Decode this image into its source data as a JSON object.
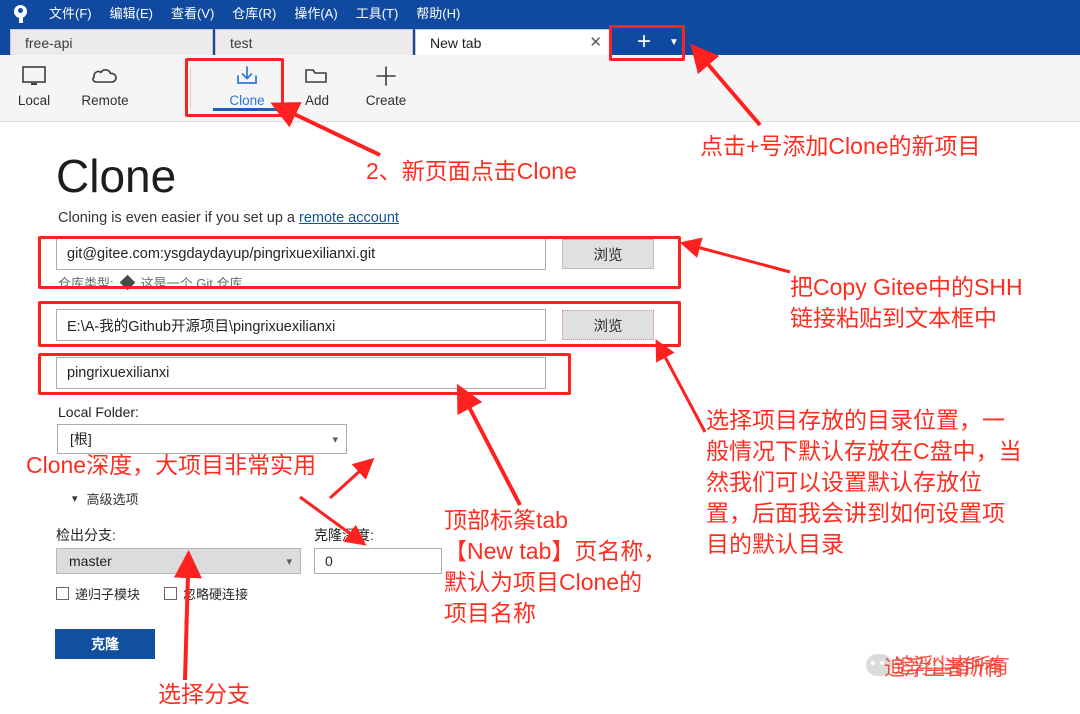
{
  "app": {
    "logo_icon": "sourcetree-logo-icon",
    "menu": [
      {
        "label": "文件(F)"
      },
      {
        "label": "编辑(E)"
      },
      {
        "label": "查看(V)"
      },
      {
        "label": "仓库(R)"
      },
      {
        "label": "操作(A)"
      },
      {
        "label": "工具(T)"
      },
      {
        "label": "帮助(H)"
      }
    ],
    "accent_color": "#1049a0",
    "annotation_color": "#ff2d20"
  },
  "tabs": {
    "items": [
      {
        "label": "free-api",
        "active": false,
        "closable": false
      },
      {
        "label": "test",
        "active": false,
        "closable": false
      },
      {
        "label": "New tab",
        "active": true,
        "closable": true,
        "close_icon": "close-icon"
      }
    ],
    "new_tab_icon": "plus-icon",
    "new_tab_caret_icon": "chevron-down-icon"
  },
  "ribbon": {
    "buttons": [
      {
        "label": "Local",
        "icon": "monitor-icon",
        "selected": false
      },
      {
        "label": "Remote",
        "icon": "cloud-icon",
        "selected": false
      },
      {
        "label": "Clone",
        "icon": "download-icon",
        "selected": true
      },
      {
        "label": "Add",
        "icon": "folder-icon",
        "selected": false
      },
      {
        "label": "Create",
        "icon": "plus-icon",
        "selected": false
      }
    ]
  },
  "main": {
    "title": "Clone",
    "subtitle_prefix": "Cloning is even easier if you set up a ",
    "subtitle_link": "remote account",
    "source_url": {
      "value": "git@gitee.com:ysgdaydayup/pingrixuexilianxi.git",
      "browse_label": "浏览"
    },
    "repo_type": {
      "label": "仓库类型:",
      "value": "这是一个 Git 仓库",
      "icon": "git-diamond-icon"
    },
    "destination_path": {
      "value": "E:\\A-我的Github开源项目\\pingrixuexilianxi",
      "browse_label": "浏览"
    },
    "name_field": {
      "value": "pingrixuexilianxi"
    },
    "local_folder": {
      "label": "Local Folder:",
      "value": "[根]",
      "caret_icon": "chevron-down-icon"
    },
    "advanced": {
      "label": "高级选项",
      "chevron_icon": "chevron-down-icon"
    },
    "checkout_branch": {
      "label": "检出分支:",
      "value": "master",
      "caret_icon": "chevron-down-icon"
    },
    "clone_depth": {
      "label": "克隆深度:",
      "value": "0"
    },
    "checkboxes": [
      {
        "label": "递归子模块",
        "checked": false
      },
      {
        "label": "忽略硬连接",
        "checked": false
      }
    ],
    "clone_button": "克隆"
  },
  "annotations": [
    {
      "id": "add-new-project",
      "text": "点击+号添加Clone的新项目"
    },
    {
      "id": "click-clone-tab",
      "text": "2、新页面点击Clone"
    },
    {
      "id": "paste-ssh-link",
      "text": "把Copy Gitee中的SHH\n链接粘贴到文本框中"
    },
    {
      "id": "choose-directory",
      "text": "选择项目存放的目录位置，一\n般情况下默认存放在C盘中，当\n然我们可以设置默认存放位\n置，后面我会讲到如何设置项\n目的默认目录"
    },
    {
      "id": "tab-name-note",
      "text": "顶部标筿tab\n【New tab】页名称，\n默认为项目Clone的\n项目名称"
    },
    {
      "id": "clone-depth-note",
      "text": "Clone深度，大项目非常实用"
    },
    {
      "id": "select-branch-note",
      "text": "选择分支"
    }
  ],
  "watermark": {
    "icon": "chat-bubble-icon",
    "text": "追浮尘者所有"
  }
}
